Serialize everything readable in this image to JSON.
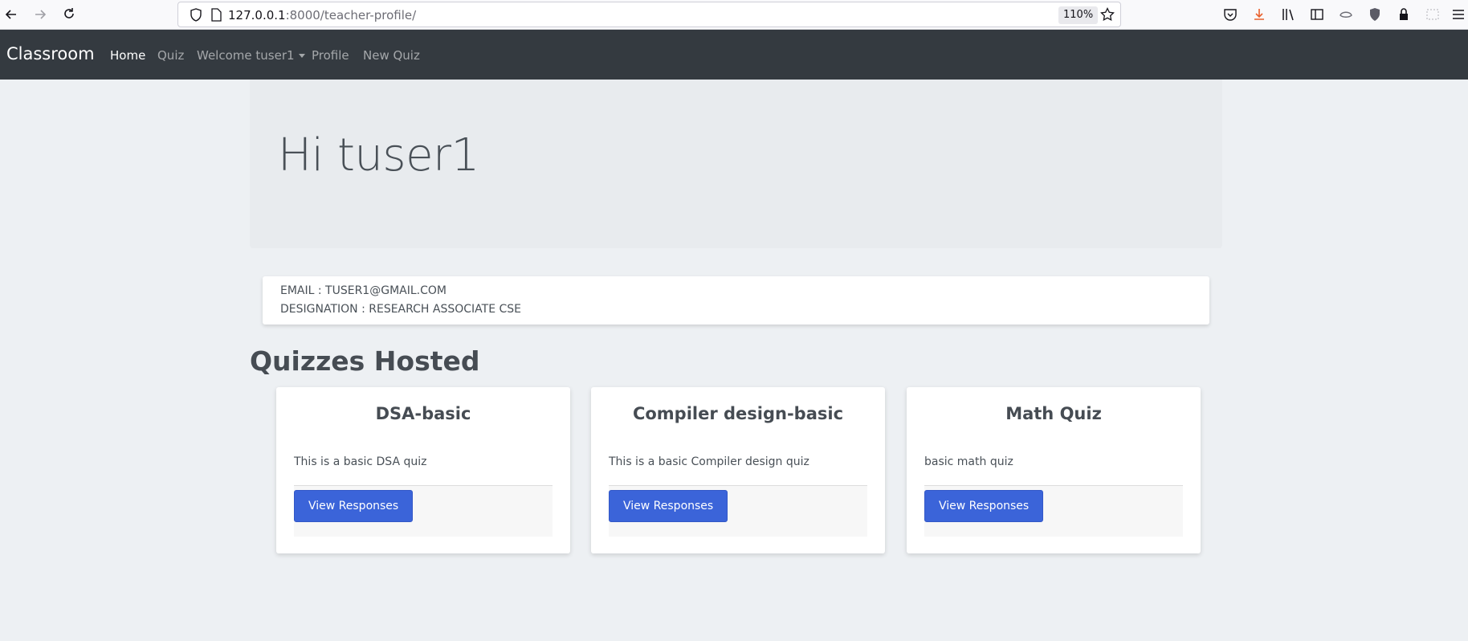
{
  "browser": {
    "url_host": "127.0.0.1",
    "url_rest": ":8000/teacher-profile/",
    "zoom": "110%"
  },
  "navbar": {
    "brand": "Classroom",
    "links": [
      "Home",
      "Quiz",
      "Welcome tuser1",
      "Profile",
      "New Quiz"
    ]
  },
  "jumbotron": {
    "title": "Hi tuser1"
  },
  "profile": {
    "email": "EMAIL : TUSER1@GMAIL.COM",
    "designation": "DESIGNATION : RESEARCH ASSOCIATE CSE"
  },
  "section_title": "Quizzes Hosted",
  "quizzes": [
    {
      "title": "DSA-basic",
      "description": "This is a basic DSA quiz",
      "button": "View Responses"
    },
    {
      "title": "Compiler design-basic",
      "description": "This is a basic Compiler design quiz",
      "button": "View Responses"
    },
    {
      "title": "Math Quiz",
      "description": "basic math quiz",
      "button": "View Responses"
    }
  ],
  "colors": {
    "navbar_bg": "#343a40",
    "button_bg": "#3b64d9",
    "page_bg": "#edf0f3"
  }
}
